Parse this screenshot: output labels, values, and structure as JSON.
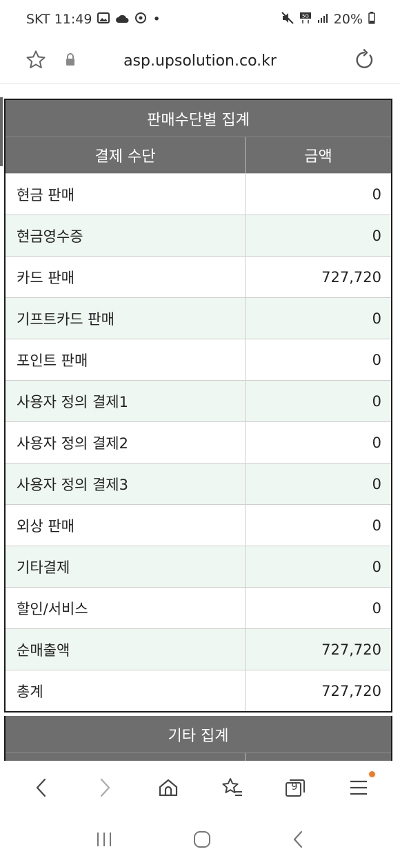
{
  "status": {
    "carrier_time": "SKT 11:49",
    "dot": "•",
    "battery": "20%"
  },
  "browser": {
    "url": "asp.upsolution.co.kr"
  },
  "sales_table": {
    "title": "판매수단별 집계",
    "col_method": "결제 수단",
    "col_amount": "금액",
    "rows": [
      {
        "label": "현금 판매",
        "amount": "0"
      },
      {
        "label": "현금영수증",
        "amount": "0"
      },
      {
        "label": "카드 판매",
        "amount": "727,720"
      },
      {
        "label": "기프트카드 판매",
        "amount": "0"
      },
      {
        "label": "포인트 판매",
        "amount": "0"
      },
      {
        "label": "사용자 정의 결제1",
        "amount": "0"
      },
      {
        "label": "사용자 정의 결제2",
        "amount": "0"
      },
      {
        "label": "사용자 정의 결제3",
        "amount": "0"
      },
      {
        "label": "외상 판매",
        "amount": "0"
      },
      {
        "label": "기타결제",
        "amount": "0"
      },
      {
        "label": "할인/서비스",
        "amount": "0"
      },
      {
        "label": "순매출액",
        "amount": "727,720"
      },
      {
        "label": "총계",
        "amount": "727,720"
      }
    ]
  },
  "other_table": {
    "title": "기타 집계"
  },
  "nav": {
    "tabs_count": "9"
  },
  "colors": {
    "header_bg": "#6e6e6e",
    "alt_row_bg": "#eef7f1",
    "notify_dot": "#f07a2a"
  }
}
